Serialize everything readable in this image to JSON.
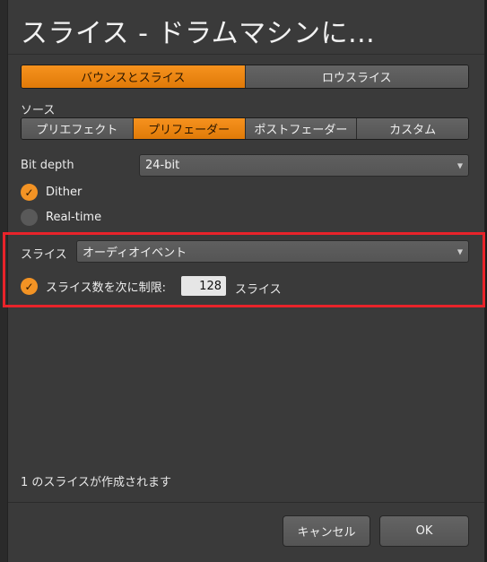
{
  "dialog": {
    "title": "スライス - ドラムマシンに..."
  },
  "mode_tabs": [
    {
      "label": "バウンスとスライス",
      "active": true
    },
    {
      "label": "ロウスライス",
      "active": false
    }
  ],
  "source": {
    "label": "ソース",
    "options": [
      {
        "label": "プリエフェクト",
        "active": false
      },
      {
        "label": "プリフェーダー",
        "active": true
      },
      {
        "label": "ポストフェーダー",
        "active": false
      },
      {
        "label": "カスタム",
        "active": false
      }
    ]
  },
  "bit_depth": {
    "label": "Bit depth",
    "value": "24-bit"
  },
  "dither": {
    "label": "Dither",
    "checked": true
  },
  "realtime": {
    "label": "Real-time",
    "checked": false
  },
  "slice": {
    "label": "スライス",
    "value": "オーディオイベント",
    "limit_label": "スライス数を次に制限:",
    "limit_checked": true,
    "limit_value": "128",
    "limit_unit": "スライス"
  },
  "status_text": "1 のスライスが作成されます",
  "buttons": {
    "cancel": "キャンセル",
    "ok": "OK"
  },
  "colors": {
    "accent": "#f39324",
    "highlight_frame": "#e8232a",
    "dialog_bg": "#3a3a3a"
  },
  "icons": {
    "check": "checkmark-icon",
    "caret": "chevron-down-icon"
  }
}
